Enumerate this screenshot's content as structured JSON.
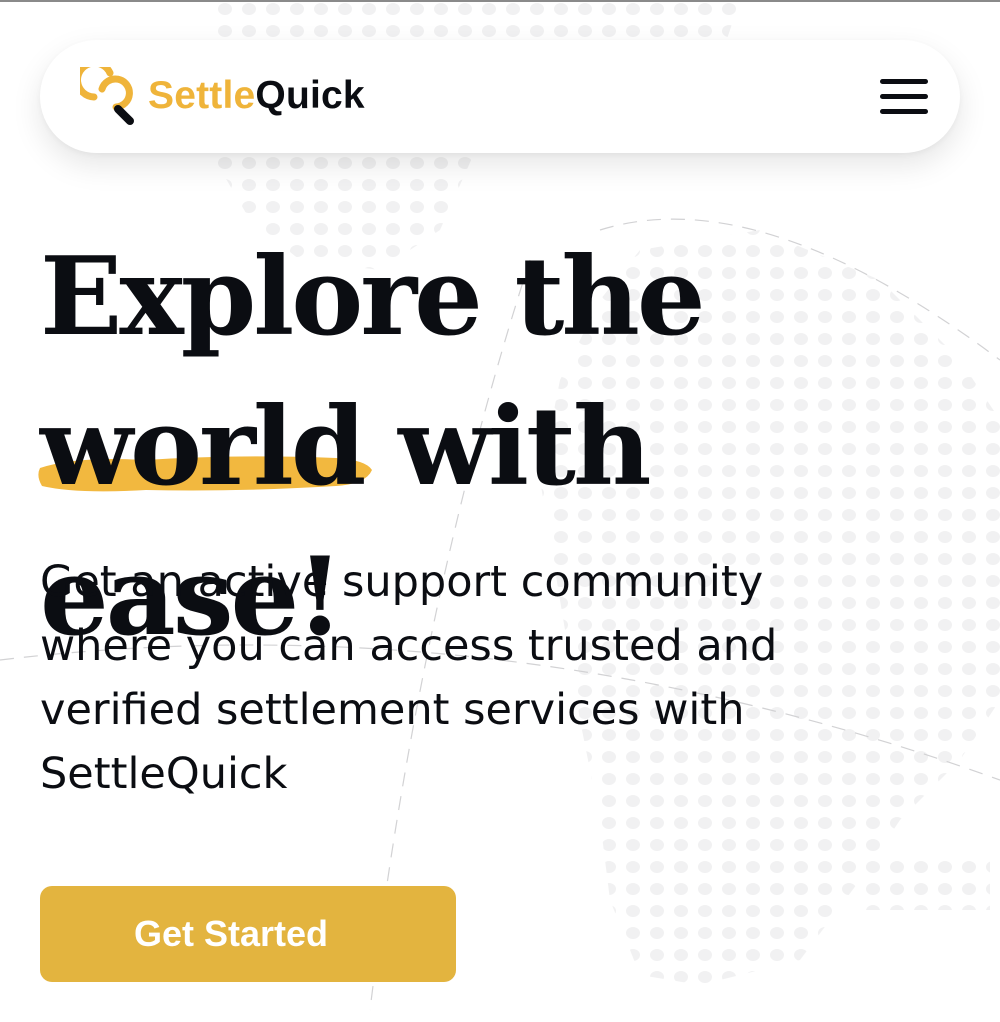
{
  "brand": {
    "name_part1": "Settle",
    "name_part2": "Quick",
    "accent_color": "#efb43a"
  },
  "header": {
    "logo_icon": "settlequick-logo-mark",
    "menu_icon": "hamburger-menu-icon"
  },
  "hero": {
    "title_line1": "Explore the",
    "title_highlight": "world",
    "title_rest": "with ease!",
    "subtitle": "Get an active support community where you can access trusted and verified settlement services with SettleQuick",
    "cta_label": "Get Started",
    "cta_color": "#e3b43f",
    "highlight_color": "#f2b83f"
  }
}
